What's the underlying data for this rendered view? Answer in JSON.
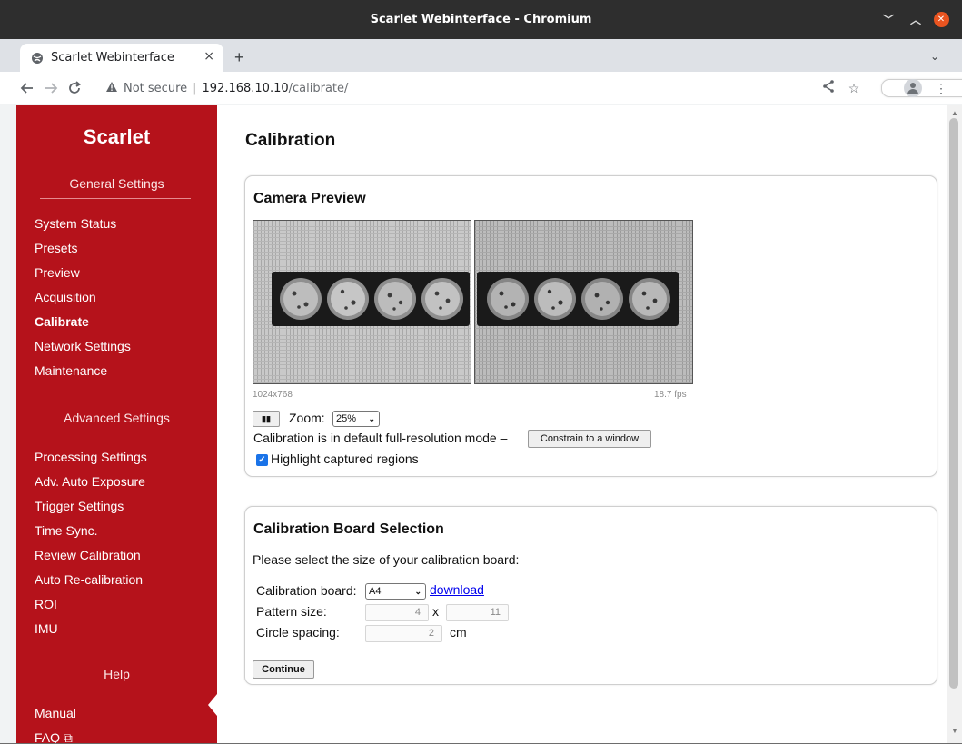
{
  "window": {
    "title": "Scarlet Webinterface - Chromium",
    "controls": {
      "minimize": "﹀",
      "maximize": "︿",
      "close": "✕"
    }
  },
  "browser": {
    "tab_title": "Scarlet Webinterface",
    "tab_close": "×",
    "new_tab": "+",
    "tab_menu": "⌄",
    "security_label": "Not secure",
    "url_host": "192.168.10.10",
    "url_path": "/calibrate/"
  },
  "sidebar": {
    "brand": "Scarlet",
    "sections": [
      {
        "title": "General Settings",
        "items": [
          "System Status",
          "Presets",
          "Preview",
          "Acquisition",
          "Calibrate",
          "Network Settings",
          "Maintenance"
        ]
      },
      {
        "title": "Advanced Settings",
        "items": [
          "Processing Settings",
          "Adv. Auto Exposure",
          "Trigger Settings",
          "Time Sync.",
          "Review Calibration",
          "Auto Re-calibration",
          "ROI",
          "IMU"
        ]
      },
      {
        "title": "Help",
        "items": [
          "Manual",
          "FAQ"
        ]
      }
    ],
    "active_item": "Calibrate"
  },
  "main": {
    "title": "Calibration",
    "camera_preview": {
      "heading": "Camera Preview",
      "resolution": "1024x768",
      "fps": "18.7 fps",
      "pause_label": "▮▮",
      "zoom_label": "Zoom:",
      "zoom_value": "25%",
      "mode_text": "Calibration is in default full-resolution mode –",
      "constrain_button": "Constrain to a window",
      "highlight_label": "Highlight captured regions",
      "highlight_checked": true
    },
    "board_selection": {
      "heading": "Calibration Board Selection",
      "instruction": "Please select the size of your calibration board:",
      "board_label": "Calibration board:",
      "board_value": "A4",
      "download_link": "download",
      "pattern_label": "Pattern size:",
      "pattern_cols": "4",
      "pattern_x": "x",
      "pattern_rows": "11",
      "spacing_label": "Circle spacing:",
      "spacing_value": "2",
      "spacing_unit": "cm",
      "continue_button": "Continue"
    }
  },
  "colors": {
    "sidebar_bg": "#b5121b",
    "titlebar_bg": "#2e2e2e",
    "close_button": "#e95420",
    "checkbox_accent": "#1a73e8"
  }
}
